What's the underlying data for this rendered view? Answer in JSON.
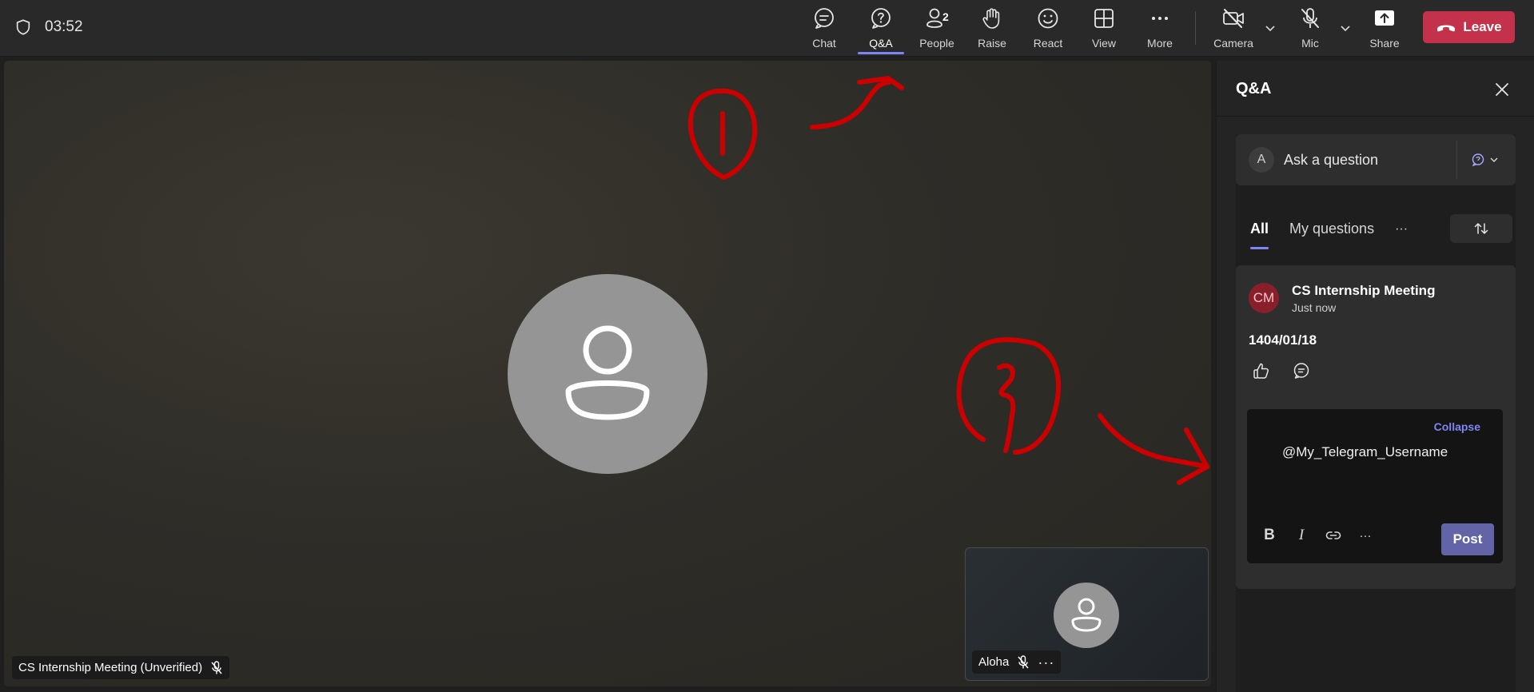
{
  "header": {
    "timer": "03:52",
    "buttons": {
      "chat": "Chat",
      "qa": "Q&A",
      "people": "People",
      "people_count": "2",
      "raise": "Raise",
      "react": "React",
      "view": "View",
      "more": "More",
      "camera": "Camera",
      "mic": "Mic",
      "share": "Share"
    },
    "leave_label": "Leave",
    "active_tab": "Q&A"
  },
  "stage": {
    "main_participant": "CS Internship Meeting (Unverified)",
    "pip_participant": "Aloha",
    "pip_more": "···"
  },
  "panel": {
    "title": "Q&A",
    "ask": {
      "avatar_initial": "A",
      "placeholder": "Ask a question"
    },
    "tabs": {
      "all": "All",
      "mine": "My questions",
      "more": "···"
    },
    "question": {
      "avatar_initials": "CM",
      "author": "CS Internship Meeting",
      "time": "Just now",
      "body": "1404/01/18"
    },
    "reply": {
      "collapse": "Collapse",
      "text": "@My_Telegram_Username",
      "more": "···",
      "post": "Post"
    }
  },
  "colors": {
    "accent": "#7f85f5",
    "leave": "#c4314b",
    "post": "#6264a7",
    "annotation": "#cc0000"
  }
}
